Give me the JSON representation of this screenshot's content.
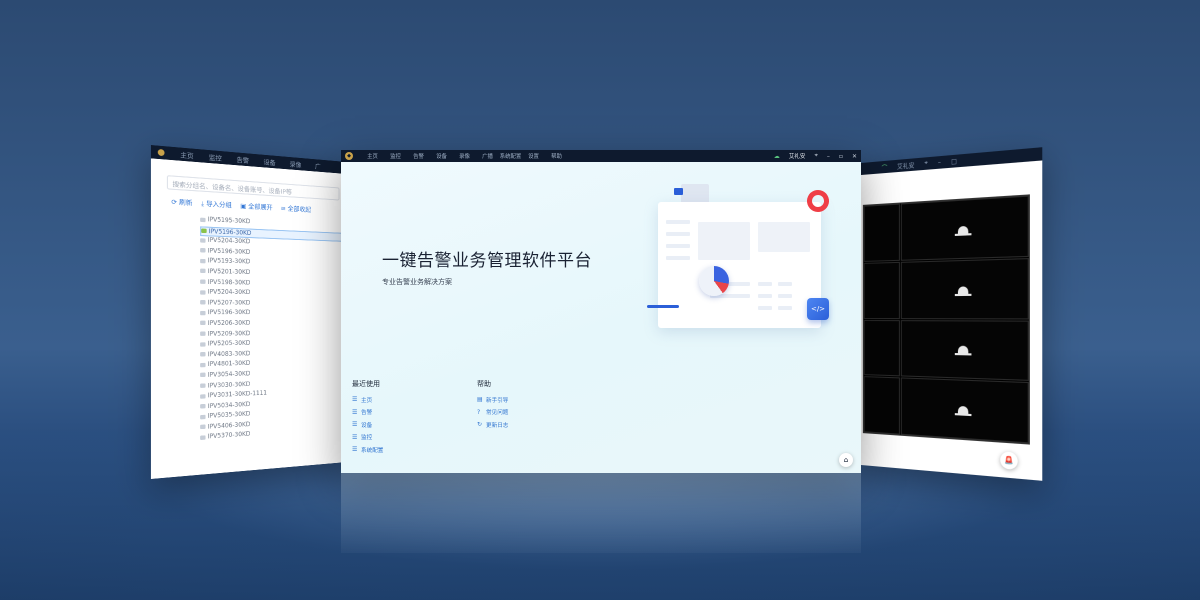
{
  "left_window": {
    "nav": [
      "主页",
      "监控",
      "告警",
      "设备",
      "录像",
      "广"
    ],
    "search_placeholder": "搜索分组名、设备名、设备账号、设备IP等",
    "tools": [
      "刷新",
      "导入分组",
      "全部展开",
      "全部收起"
    ],
    "devices": [
      "IPV5195-30KD",
      "IPV5196-30KD",
      "IPV5204-30KD",
      "IPV5196-30KD",
      "IPV5193-30KD",
      "IPV5201-30KD",
      "IPV5198-30KD",
      "IPV5204-30KD",
      "IPV5207-30KD",
      "IPV5196-30KD",
      "IPV5206-30KD",
      "IPV5209-30KD",
      "IPV5205-30KD",
      "IPV4083-30KD",
      "IPV4801-30KD",
      "IPV3054-30KD",
      "IPV3030-30KD",
      "IPV3031-30KD-1111",
      "IPV5034-30KD",
      "IPV5035-30KD",
      "IPV5406-30KD",
      "IPV5370-30KD"
    ],
    "selected_index": 1
  },
  "main_window": {
    "nav": [
      "主页",
      "监控",
      "告警",
      "设备",
      "录像",
      "广播",
      "系统配置",
      "设置",
      "帮助"
    ],
    "user_label": "艾礼安",
    "hero_title": "一键告警业务管理软件平台",
    "hero_subtitle": "专业告警业务解决方案",
    "recent": {
      "title": "最近使用",
      "items": [
        "主页",
        "告警",
        "设备",
        "监控",
        "系统配置"
      ]
    },
    "help": {
      "title": "帮助",
      "items": [
        "新手引导",
        "常见问题",
        "更新日志"
      ]
    }
  },
  "right_window": {
    "user_label": "艾礼安",
    "cell_count": 8
  },
  "colors": {
    "titlebar": "#0e1a2e",
    "link": "#2f74d0",
    "accent_red": "#ef3e46",
    "accent_blue": "#2b5fd8"
  }
}
